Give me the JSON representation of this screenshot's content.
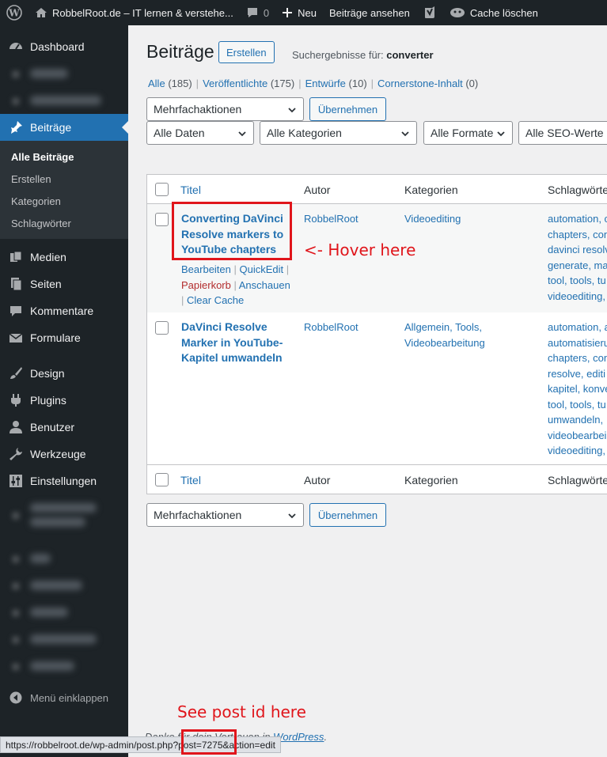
{
  "adminbar": {
    "site_title": "RobbelRoot.de – IT lernen & verstehe...",
    "comments_count": "0",
    "new_label": "Neu",
    "view_posts_label": "Beiträge ansehen",
    "cache_label": "Cache löschen"
  },
  "sidebar": {
    "dashboard": "Dashboard",
    "posts": "Beiträge",
    "submenu": [
      "Alle Beiträge",
      "Erstellen",
      "Kategorien",
      "Schlagwörter"
    ],
    "media": "Medien",
    "pages": "Seiten",
    "comments": "Kommentare",
    "forms": "Formulare",
    "design": "Design",
    "plugins": "Plugins",
    "users": "Benutzer",
    "tools": "Werkzeuge",
    "settings": "Einstellungen",
    "collapse": "Menü einklappen"
  },
  "page": {
    "title": "Beiträge",
    "add_new": "Erstellen",
    "search_prefix": "Suchergebnisse für:",
    "search_term": "converter"
  },
  "views": {
    "all": "Alle",
    "all_count": "(185)",
    "published": "Veröffentlichte",
    "published_count": "(175)",
    "drafts": "Entwürfe",
    "drafts_count": "(10)",
    "cornerstone": "Cornerstone-Inhalt",
    "cornerstone_count": "(0)"
  },
  "filters": {
    "bulk_actions": "Mehrfachaktionen",
    "apply": "Übernehmen",
    "dates": "Alle Daten",
    "categories": "Alle Kategorien",
    "formats": "Alle Formate",
    "seo": "Alle SEO-Werte"
  },
  "table": {
    "headers": {
      "title": "Titel",
      "author": "Autor",
      "categories": "Kategorien",
      "tags": "Schlagwörte"
    },
    "rows": [
      {
        "title": "Converting DaVinci Resolve markers to YouTube chapters",
        "actions": {
          "edit": "Bearbeiten",
          "quickedit": "QuickEdit",
          "trash": "Papierkorb",
          "view": "Anschauen",
          "clear_cache": "Clear Cache"
        },
        "author": "RobbelRoot",
        "categories": "Videoediting",
        "tags": [
          "automation, c",
          "chapters, con",
          "davinci resolv",
          "generate, ma",
          "tool, tools, tu",
          "videoediting,"
        ]
      },
      {
        "title": "DaVinci Resolve Marker in YouTube-Kapitel umwandeln",
        "author": "RobbelRoot",
        "categories": "Allgemein, Tools, Videobearbeitung",
        "tags": [
          "automation, a",
          "automatisieru",
          "chapters, con",
          "resolve, editi",
          "kapitel, konve",
          "tool, tools, tu",
          "umwandeln,",
          "videobearbei",
          "videoediting,"
        ]
      }
    ]
  },
  "annotations": {
    "hover": "<- Hover here",
    "post_id": "See post id here"
  },
  "footer": {
    "text_before": "Danke für dein Vertrauen in",
    "link": "WordPress",
    "text_after": "."
  },
  "statusbar_url": "https://robbelroot.de/wp-admin/post.php?post=7275&action=edit",
  "colors": {
    "accent": "#2271b1",
    "annotation": "#e0151b",
    "sidebar": "#1d2327"
  }
}
